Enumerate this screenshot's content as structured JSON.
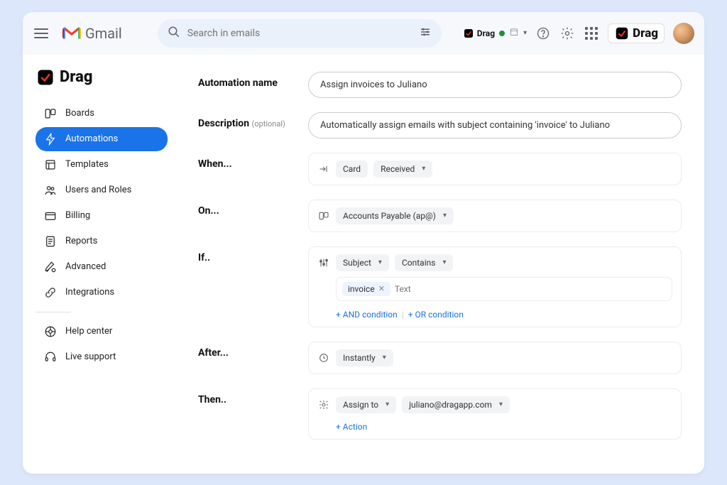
{
  "topbar": {
    "gmail_text": "Gmail",
    "search_placeholder": "Search in emails",
    "drag_chip": "Drag",
    "brand_text": "Drag"
  },
  "sidebar": {
    "brand": "Drag",
    "items": [
      {
        "label": "Boards"
      },
      {
        "label": "Automations"
      },
      {
        "label": "Templates"
      },
      {
        "label": "Users and Roles"
      },
      {
        "label": "Billing"
      },
      {
        "label": "Reports"
      },
      {
        "label": "Advanced"
      },
      {
        "label": "Integrations"
      }
    ],
    "footer": [
      {
        "label": "Help center"
      },
      {
        "label": "Live support"
      }
    ]
  },
  "form": {
    "name_label": "Automation name",
    "name_value": "Assign invoices to Juliano",
    "desc_label": "Description ",
    "desc_opt": "(optional)",
    "desc_value": "Automatically assign emails with subject containing 'invoice' to Juliano",
    "when_label": "When...",
    "when_card": "Card",
    "when_received": "Received",
    "on_label": "On...",
    "on_board": "Accounts Payable (ap@)",
    "if_label": "If..",
    "if_field": "Subject",
    "if_op": "Contains",
    "if_tag": "invoice",
    "if_placeholder": "Text",
    "and_cond": "+ AND condition",
    "or_cond": "+ OR condition",
    "after_label": "After...",
    "after_value": "Instantly",
    "then_label": "Then..",
    "then_action": "Assign to",
    "then_target": "juliano@dragapp.com",
    "add_action": "+ Action"
  }
}
